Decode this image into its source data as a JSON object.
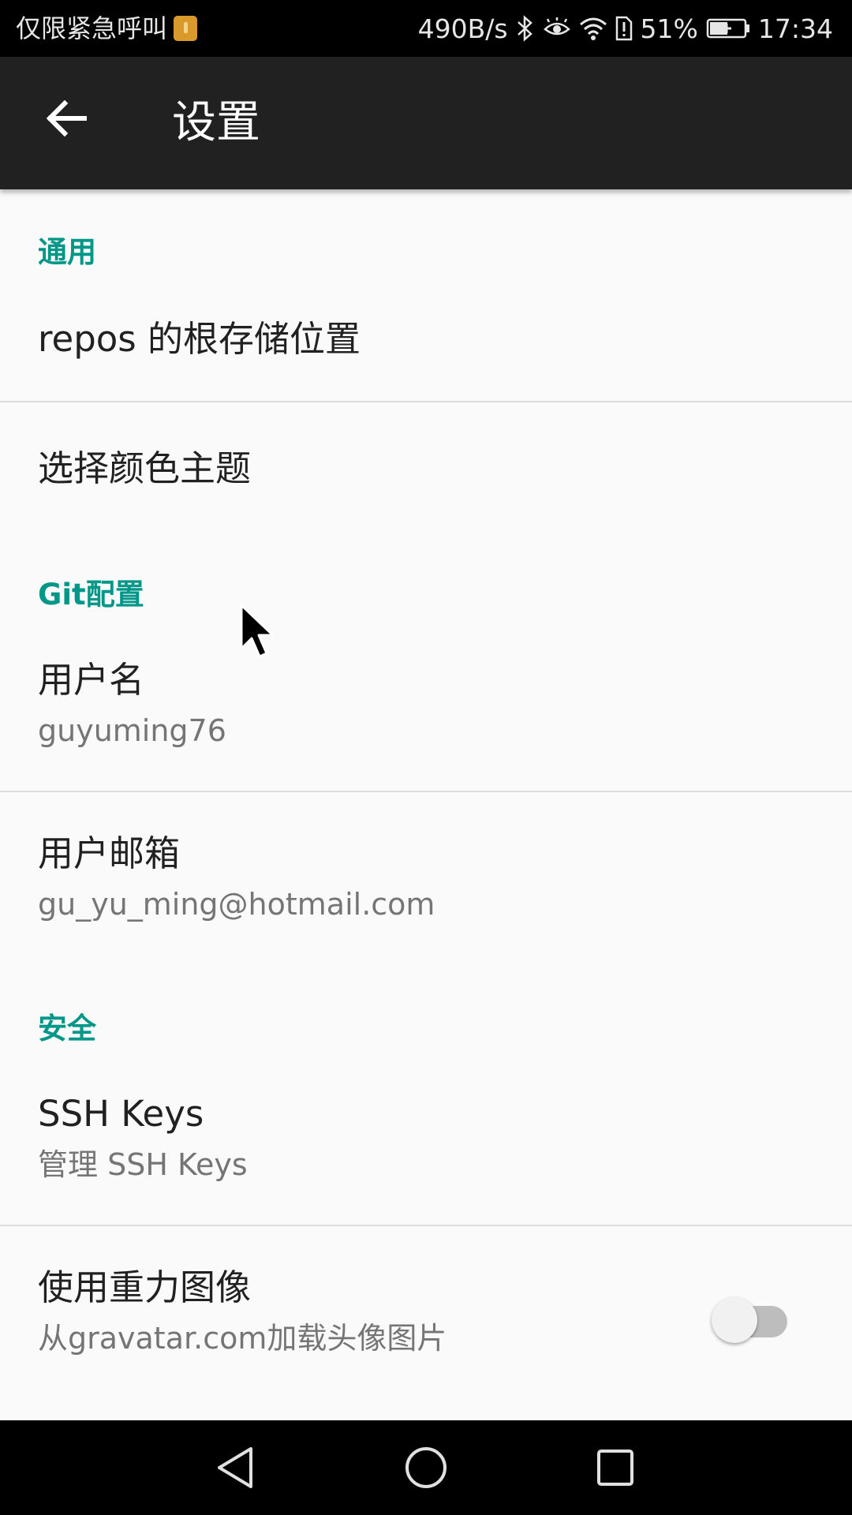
{
  "status_bar": {
    "carrier": "仅限紧急呼叫",
    "net_speed": "490B/s",
    "battery": "51%",
    "time": "17:34"
  },
  "app_bar": {
    "title": "设置"
  },
  "sections": {
    "general": {
      "header": "通用",
      "repos_location": {
        "title": "repos 的根存储位置"
      },
      "color_theme": {
        "title": "选择颜色主题"
      }
    },
    "git": {
      "header": "Git配置",
      "username": {
        "title": "用户名",
        "summary": "guyuming76"
      },
      "email": {
        "title": "用户邮箱",
        "summary": "gu_yu_ming@hotmail.com"
      }
    },
    "security": {
      "header": "安全",
      "ssh_keys": {
        "title": "SSH Keys",
        "summary": "管理 SSH Keys"
      },
      "gravatar": {
        "title": "使用重力图像",
        "summary": "从gravatar.com加载头像图片",
        "enabled": false
      }
    }
  },
  "colors": {
    "accent": "#009688",
    "app_bar": "#212121",
    "background": "#fafafa"
  }
}
